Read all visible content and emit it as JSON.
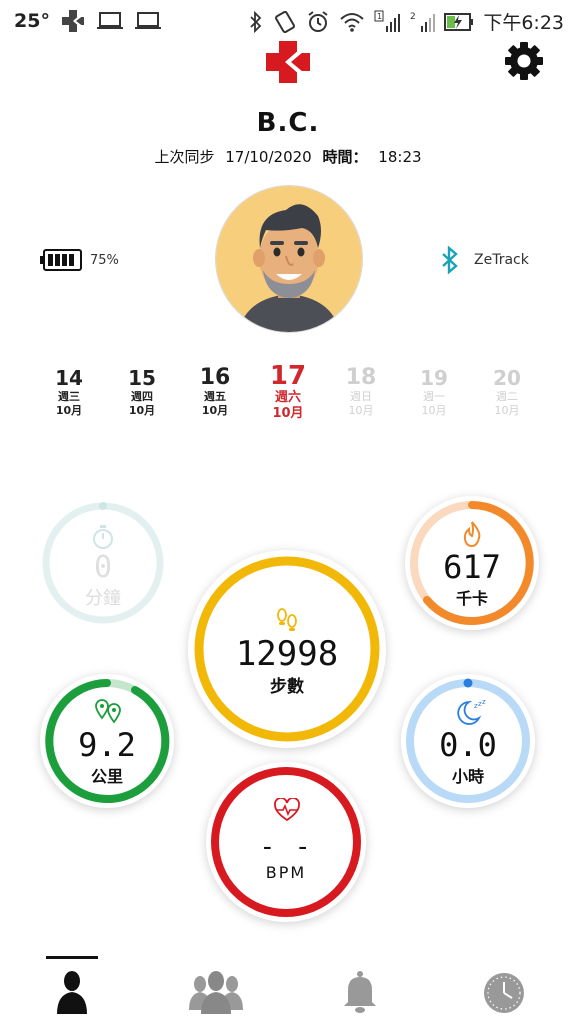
{
  "status_bar": {
    "temperature": "25°",
    "time": "下午6:23"
  },
  "user": {
    "name": "B.C."
  },
  "sync": {
    "label": "上次同步",
    "date": "17/10/2020",
    "time_label": "時間：",
    "time": "18:23"
  },
  "device": {
    "battery": "75%",
    "battery_level": 0.75,
    "name": "ZeTrack"
  },
  "dates": [
    {
      "day": "14",
      "weekday": "週三",
      "month": "10月",
      "state": "past"
    },
    {
      "day": "15",
      "weekday": "週四",
      "month": "10月",
      "state": "past"
    },
    {
      "day": "16",
      "weekday": "週五",
      "month": "10月",
      "state": "past"
    },
    {
      "day": "17",
      "weekday": "週六",
      "month": "10月",
      "state": "selected"
    },
    {
      "day": "18",
      "weekday": "週日",
      "month": "10月",
      "state": "future"
    },
    {
      "day": "19",
      "weekday": "週一",
      "month": "10月",
      "state": "future"
    },
    {
      "day": "20",
      "weekday": "週二",
      "month": "10月",
      "state": "future"
    }
  ],
  "metrics": {
    "active_time": {
      "value": "0",
      "unit": "分鐘",
      "color": "#d7ecec",
      "progress": 0.0
    },
    "steps": {
      "value": "12998",
      "unit": "步數",
      "color": "#f2b807",
      "progress": 1.0
    },
    "calories": {
      "value": "617",
      "unit": "千卡",
      "color": "#f28a2c",
      "track": "#f9d8bd",
      "progress": 0.62
    },
    "distance": {
      "value": "9.2",
      "unit": "公里",
      "color": "#1c9e3c",
      "track": "#bfe3c8",
      "progress": 0.9
    },
    "sleep": {
      "value": "0.0",
      "unit": "小時",
      "color": "#b5d8f6",
      "accent": "#2a7de1",
      "progress": 0.0
    },
    "heart_rate": {
      "value": "- -",
      "unit": "BPM",
      "color": "#d71920",
      "progress": 1.0
    }
  },
  "nav": [
    "profile-tab",
    "friends-tab",
    "notifications-tab",
    "history-tab"
  ],
  "colors": {
    "brand": "#d71920",
    "selected_date": "#d0282d",
    "bluetooth": "#1aa3b8"
  }
}
